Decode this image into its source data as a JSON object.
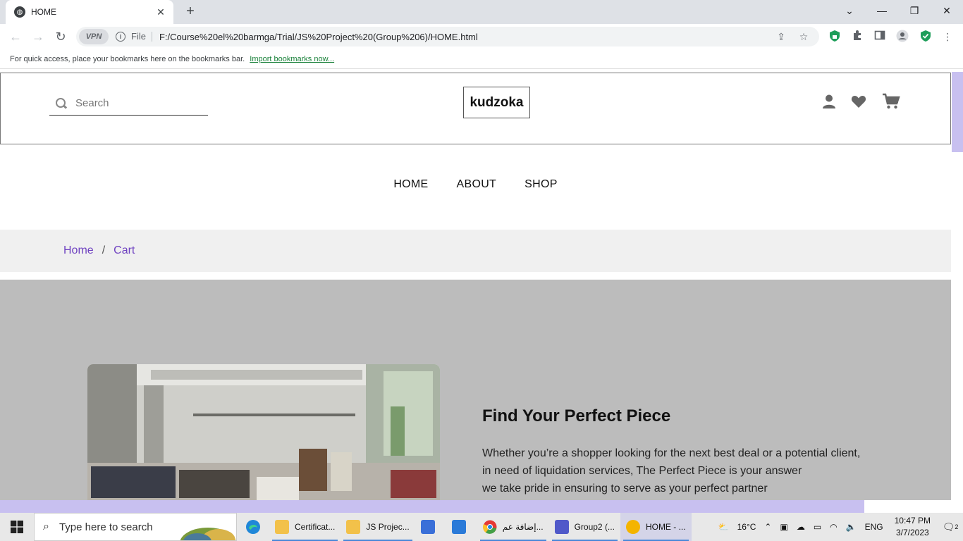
{
  "browser": {
    "tab_title": "HOME",
    "new_tab_label": "+",
    "url_scheme_label": "File",
    "vpn_label": "VPN",
    "url": "F:/Course%20el%20barmga/Trial/JS%20Project%20(Group%206)/HOME.html"
  },
  "bookmarks_bar": {
    "message": "For quick access, place your bookmarks here on the bookmarks bar.",
    "import_link": "Import bookmarks now..."
  },
  "site": {
    "search_placeholder": "Search",
    "logo": "kudzoka",
    "nav": [
      {
        "label": "HOME"
      },
      {
        "label": "ABOUT"
      },
      {
        "label": "SHOP"
      }
    ],
    "breadcrumb": {
      "home": "Home",
      "separator": "/",
      "current": "Cart"
    },
    "about": {
      "title": "Find Your Perfect Piece",
      "lines": [
        "Whether you’re a shopper looking for the next best deal or a potential client,",
        "in need of liquidation services, The Perfect Piece is your answer",
        "we take pride in ensuring to serve as your perfect partner"
      ]
    },
    "colors": {
      "accent_purple": "#6f42c1",
      "section_gray": "#bcbcbc",
      "scroll_thumb": "#c8c0f0"
    }
  },
  "taskbar": {
    "search_placeholder": "Type here to search",
    "apps": [
      {
        "label": "Certificat..."
      },
      {
        "label": "JS Projec..."
      },
      {
        "label": "إضافة عم..."
      },
      {
        "label": "Group2 (..."
      },
      {
        "label": "HOME - ..."
      }
    ],
    "weather": "16°C",
    "language": "ENG",
    "time": "10:47 PM",
    "date": "3/7/2023",
    "notifications": "2"
  }
}
